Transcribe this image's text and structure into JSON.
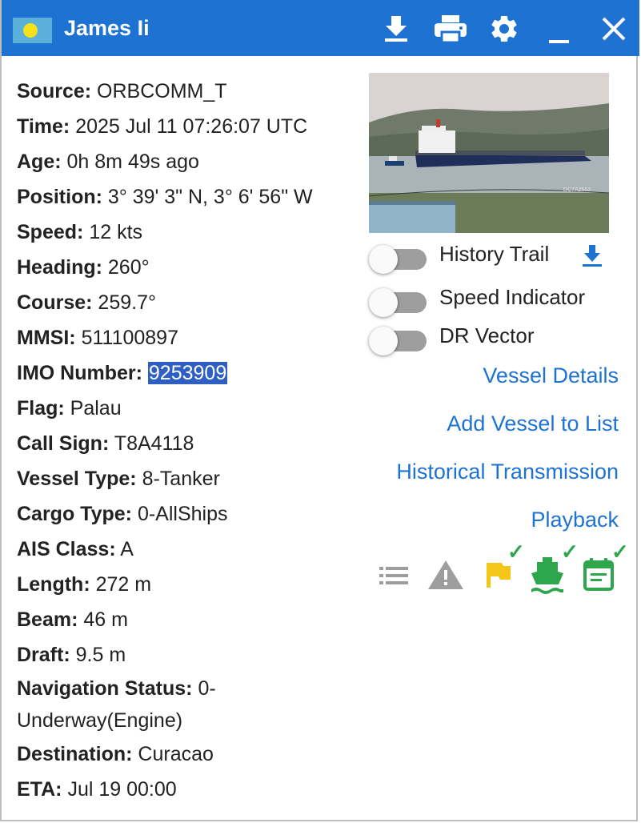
{
  "window": {
    "title": "James Ii",
    "flag_icon": "palau-flag-icon",
    "buttons": {
      "download": "download-icon",
      "print": "print-icon",
      "settings": "gear-icon",
      "minimize": "minimize-icon",
      "close": "close-icon"
    },
    "colors": {
      "titlebar": "#1e73d2",
      "link": "#1e73d2",
      "highlight": "#2f5fc0",
      "ok": "#2ea64b",
      "flag": "#f5c518"
    }
  },
  "details": [
    {
      "label": "Source:",
      "value": "ORBCOMM_T"
    },
    {
      "label": "Time:",
      "value": "2025 Jul 11 07:26:07 UTC"
    },
    {
      "label": "Age:",
      "value": "0h 8m 49s ago"
    },
    {
      "label": "Position:",
      "value": " 3° 39' 3\" N, 3° 6' 56\" W"
    },
    {
      "label": "Speed:",
      "value": "12 kts"
    },
    {
      "label": "Heading:",
      "value": "260°"
    },
    {
      "label": "Course:",
      "value": "259.7°"
    },
    {
      "label": "MMSI:",
      "value": "511100897"
    },
    {
      "label": "IMO Number:",
      "value": "9253909"
    },
    {
      "label": "Flag:",
      "value": "Palau"
    },
    {
      "label": "Call Sign:",
      "value": "T8A4118"
    },
    {
      "label": "Vessel Type:",
      "value": "8-Tanker"
    },
    {
      "label": "Cargo Type:",
      "value": "0-AllShips"
    },
    {
      "label": "AIS Class:",
      "value": "A"
    },
    {
      "label": "Length:",
      "value": "272 m"
    },
    {
      "label": "Beam:",
      "value": "46 m"
    },
    {
      "label": "Draft:",
      "value": "9.5 m"
    },
    {
      "label": "Navigation Status:",
      "value": "0-Underway(Engine)"
    },
    {
      "label": "Destination:",
      "value": "Curacao"
    },
    {
      "label": "ETA:",
      "value": "Jul 19 00:00"
    }
  ],
  "photo": {
    "caption": "OC7A2552"
  },
  "toggles": [
    {
      "label": "History Trail",
      "on": false
    },
    {
      "label": "Speed Indicator",
      "on": false
    },
    {
      "label": "DR Vector",
      "on": false
    }
  ],
  "links": {
    "vessel_details": "Vessel Details",
    "add_to_list": "Add Vessel to List",
    "historical": "Historical Transmission",
    "playback": "Playback"
  },
  "status_icons": [
    "list-icon",
    "warning-icon",
    "flag-icon",
    "ship-icon",
    "calendar-icon"
  ],
  "status_checks": {
    "flag": "✓",
    "ship": "✓",
    "calendar": "✓"
  }
}
